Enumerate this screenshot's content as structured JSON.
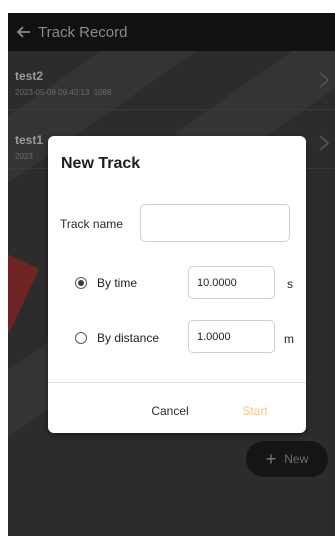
{
  "header": {
    "title": "Track Record",
    "back_icon": "arrow-left-icon"
  },
  "records": [
    {
      "name": "test2",
      "date": "2023-05-08 09:43:13",
      "count": "1088"
    },
    {
      "name": "test1",
      "date": "2023",
      "count": ""
    }
  ],
  "fab": {
    "label": "New",
    "icon": "plus-icon"
  },
  "dialog": {
    "title": "New Track",
    "track_name_label": "Track name",
    "track_name_value": "",
    "options": [
      {
        "label": "By time",
        "value": "10.0000",
        "unit": "s",
        "selected": true
      },
      {
        "label": "By distance",
        "value": "1.0000",
        "unit": "m",
        "selected": false
      }
    ],
    "cancel_label": "Cancel",
    "start_label": "Start"
  },
  "colors": {
    "accent": "#f7c873",
    "background": "#2c2c2c",
    "topbar": "#111111",
    "dialog": "#ffffff"
  }
}
